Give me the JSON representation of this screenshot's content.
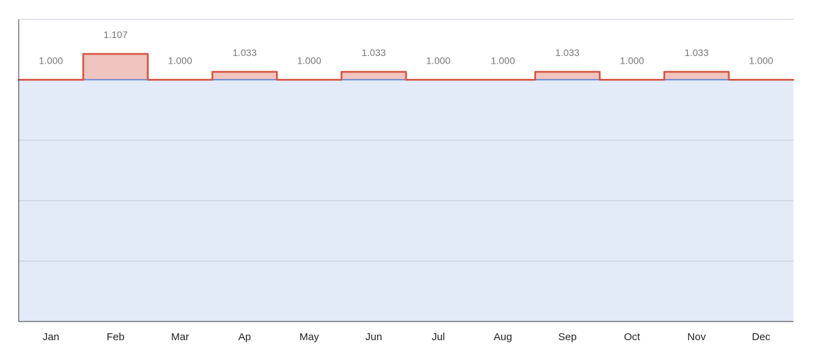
{
  "chart_data": {
    "type": "area",
    "categories": [
      "Jan",
      "Feb",
      "Mar",
      "Ap",
      "May",
      "Jun",
      "Jul",
      "Aug",
      "Sep",
      "Oct",
      "Nov",
      "Dec"
    ],
    "series": [
      {
        "values": [
          1.0,
          1.0,
          1.0,
          1.0,
          1.0,
          1.0,
          1.0,
          1.0,
          1.0,
          1.0,
          1.0,
          1.0
        ],
        "color": "#4a78d6",
        "fill": "#e3eaf8"
      },
      {
        "values": [
          1.0,
          1.107,
          1.0,
          1.033,
          1.0,
          1.033,
          1.0,
          1.0,
          1.033,
          1.0,
          1.033,
          1.0
        ],
        "color": "#d6513f",
        "fill": "#f0c4bf"
      }
    ],
    "data_labels": [
      "1.000",
      "1.107",
      "1.000",
      "1.033",
      "1.000",
      "1.033",
      "1.000",
      "1.000",
      "1.033",
      "1.000",
      "1.033",
      "1.000"
    ],
    "step": true,
    "ylim": [
      0,
      1.25
    ],
    "gridlines_y": [
      0.25,
      0.5,
      0.75,
      1.0,
      1.25
    ],
    "grid": true,
    "legend": "none",
    "title": "",
    "xlabel": "",
    "ylabel": "",
    "axis_color": "#333333",
    "grid_color": "#c4ccd8"
  }
}
